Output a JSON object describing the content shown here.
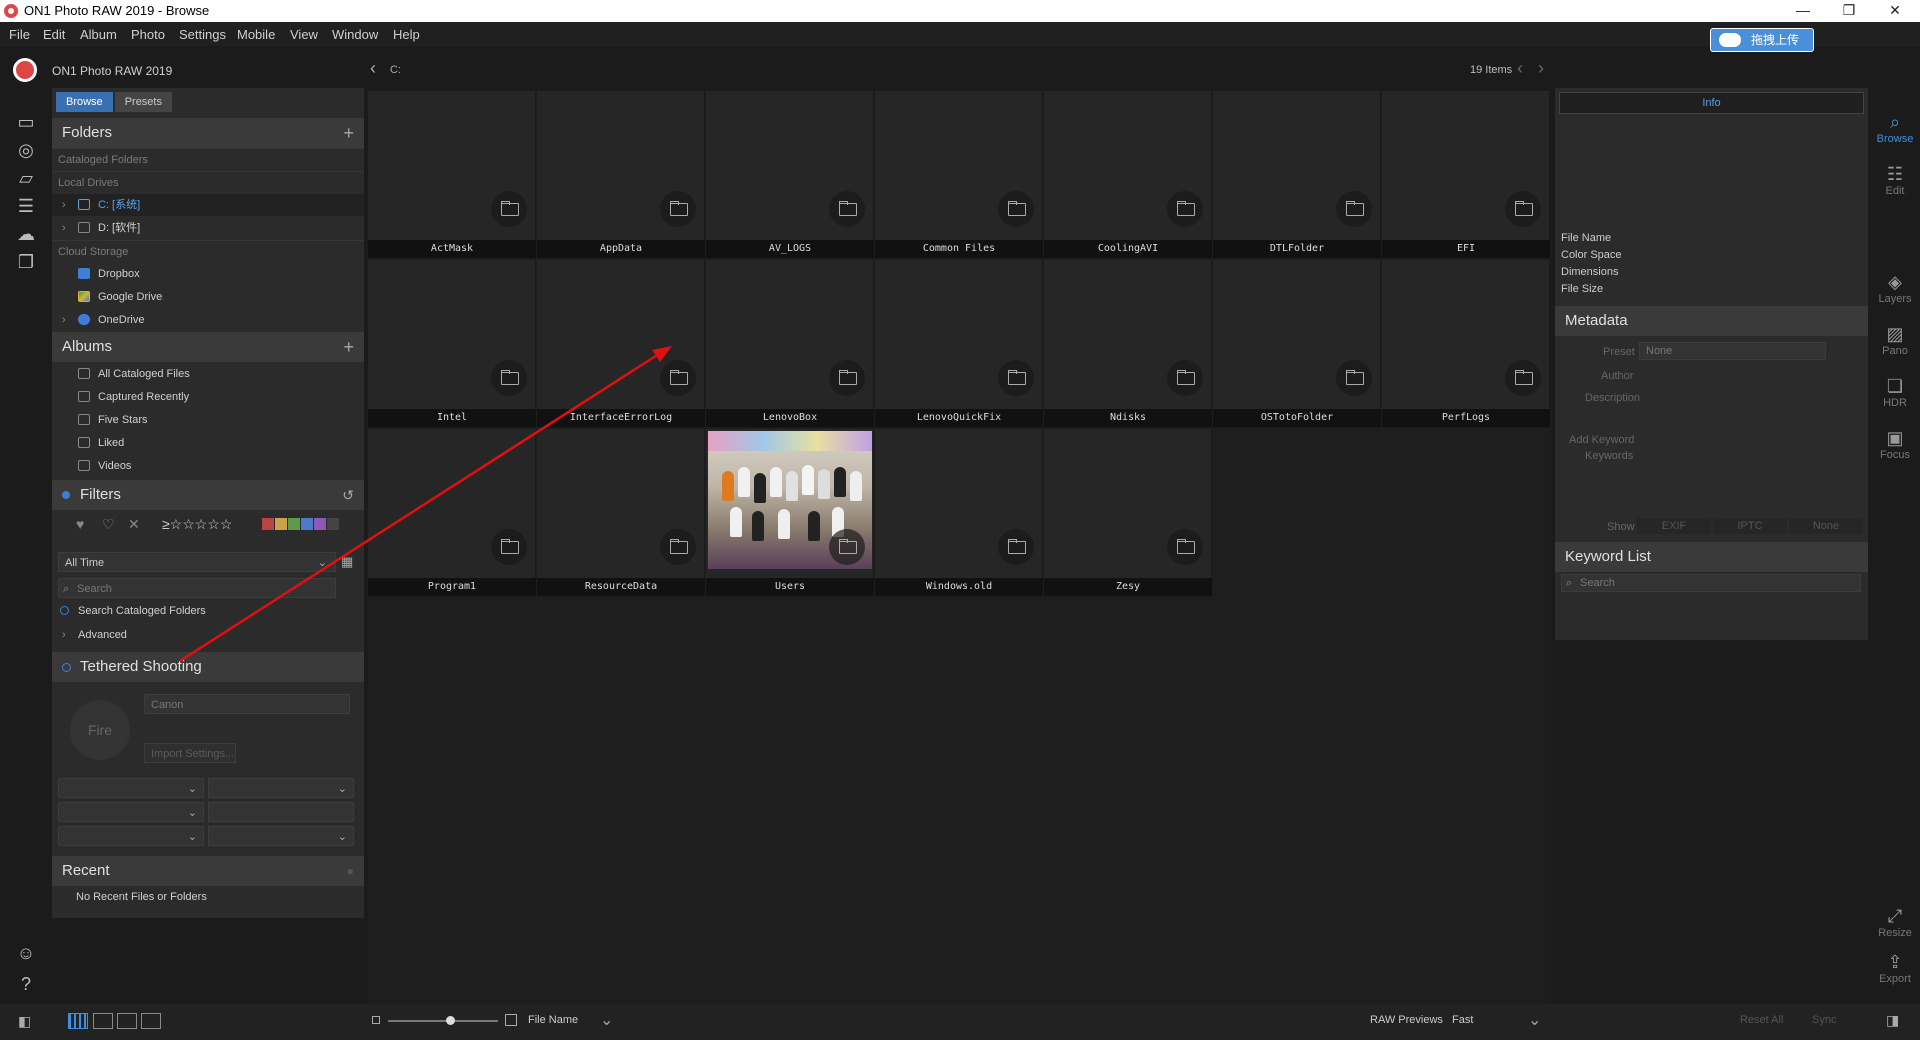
{
  "window": {
    "title": "ON1 Photo RAW 2019 - Browse",
    "min": "—",
    "max": "❐",
    "close": "✕"
  },
  "menu": [
    "File",
    "Edit",
    "Album",
    "Photo",
    "Settings",
    "Mobile",
    "View",
    "Window",
    "Help"
  ],
  "upload_button": "拖拽上传",
  "app": {
    "name": "ON1 Photo RAW 2019",
    "logo_text": "ON1"
  },
  "nav": {
    "path": "C:",
    "item_count": "19 Items"
  },
  "left_tabs": [
    "Browse",
    "Presets"
  ],
  "folders": {
    "title": "Folders",
    "cataloged": "Cataloged Folders",
    "local_drives": "Local Drives",
    "drives": [
      "C: [系统]",
      "D: [软件]"
    ],
    "cloud_storage": "Cloud Storage",
    "cloud": [
      "Dropbox",
      "Google Drive",
      "OneDrive"
    ]
  },
  "albums": {
    "title": "Albums",
    "items": [
      "All Cataloged Files",
      "Captured Recently",
      "Five Stars",
      "Liked",
      "Videos"
    ]
  },
  "filters": {
    "title": "Filters",
    "stars": "≥☆☆☆☆☆",
    "time": "All Time",
    "search_placeholder": "Search",
    "search_cataloged": "Search Cataloged Folders",
    "advanced": "Advanced",
    "colors": [
      "#b44",
      "#c9a24a",
      "#5a9a4a",
      "#4a7ac9",
      "#8a5ab4",
      "#444"
    ]
  },
  "tethered": {
    "title": "Tethered Shooting",
    "fire": "Fire",
    "camera": "Canon",
    "import": "Import Settings..."
  },
  "recent": {
    "title": "Recent",
    "empty": "No Recent Files or Folders"
  },
  "grid": [
    "ActMask",
    "AppData",
    "AV_LOGS",
    "Common Files",
    "CoolingAVI",
    "DTLFolder",
    "EFI",
    "Intel",
    "InterfaceErrorLog",
    "LenovoBox",
    "LenovoQuickFix",
    "Ndisks",
    "OSTotoFolder",
    "PerfLogs",
    "Program1",
    "ResourceData",
    "Users",
    "Windows.old",
    "Zesy"
  ],
  "info": {
    "tab": "Info",
    "fields": [
      "File Name",
      "Color Space",
      "Dimensions",
      "File Size"
    ]
  },
  "metadata": {
    "title": "Metadata",
    "preset_label": "Preset",
    "preset_value": "None",
    "author": "Author",
    "description": "Description",
    "add_keyword": "Add Keyword",
    "keywords": "Keywords",
    "show": "Show",
    "tabs": [
      "EXIF",
      "IPTC",
      "None"
    ]
  },
  "keyword_list": {
    "title": "Keyword List",
    "search_placeholder": "Search"
  },
  "right_rail": [
    "Browse",
    "Edit",
    "Layers",
    "Pano",
    "HDR",
    "Focus",
    "Resize",
    "Export"
  ],
  "bottom": {
    "sort": "File Name",
    "raw_label": "RAW Previews",
    "raw_value": "Fast",
    "reset": "Reset All",
    "sync": "Sync"
  },
  "colors": {
    "accent": "#3a6fb3",
    "link": "#5aa0e8",
    "annotation": "#e01010"
  }
}
